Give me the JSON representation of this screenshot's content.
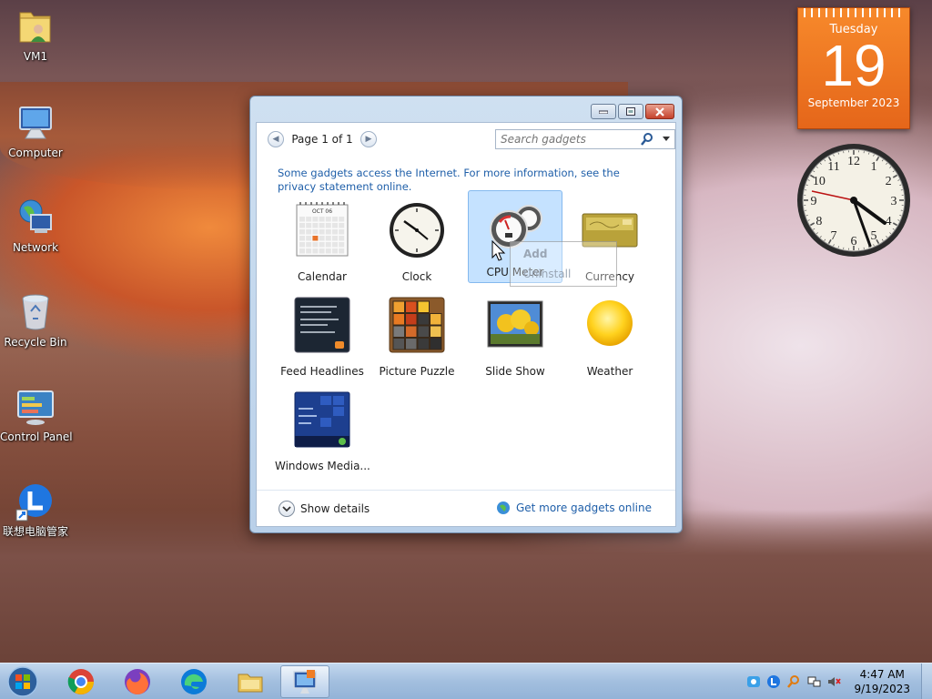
{
  "desktop": {
    "icons": [
      {
        "label": "VM1"
      },
      {
        "label": "Computer"
      },
      {
        "label": "Network"
      },
      {
        "label": "Recycle Bin"
      },
      {
        "label": "Control Panel"
      },
      {
        "label": "联想电脑管家"
      }
    ]
  },
  "calendar_gadget": {
    "weekday": "Tuesday",
    "day": "19",
    "month_year": "September 2023"
  },
  "clock_gadget": {
    "numerals": [
      "12",
      "1",
      "2",
      "3",
      "4",
      "5",
      "6",
      "7",
      "8",
      "9",
      "10",
      "11"
    ]
  },
  "dialog": {
    "pager_label": "Page 1 of 1",
    "search_placeholder": "Search gadgets",
    "info_text": "Some gadgets access the Internet.  For more information, see the privacy statement online.",
    "gadgets": [
      {
        "name": "Calendar",
        "icon": "calendar-icon"
      },
      {
        "name": "Clock",
        "icon": "clock-icon"
      },
      {
        "name": "CPU Meter",
        "icon": "cpu-meter-icon",
        "selected": true
      },
      {
        "name": "Currency",
        "icon": "currency-icon"
      },
      {
        "name": "Feed Headlines",
        "icon": "feed-headlines-icon"
      },
      {
        "name": "Picture Puzzle",
        "icon": "picture-puzzle-icon"
      },
      {
        "name": "Slide Show",
        "icon": "slide-show-icon"
      },
      {
        "name": "Weather",
        "icon": "weather-icon"
      },
      {
        "name": "Windows Media...",
        "icon": "windows-media-center-icon"
      }
    ],
    "calendar_thumb_month": "OCT 06",
    "context_menu": {
      "add": "Add",
      "uninstall": "Uninstall"
    },
    "show_details": "Show details",
    "get_more": "Get more gadgets online"
  },
  "taskbar": {
    "time": "4:47 AM",
    "date": "9/19/2023"
  },
  "colors": {
    "link": "#1f5fa9",
    "calendar_orange": "#f07d24"
  }
}
